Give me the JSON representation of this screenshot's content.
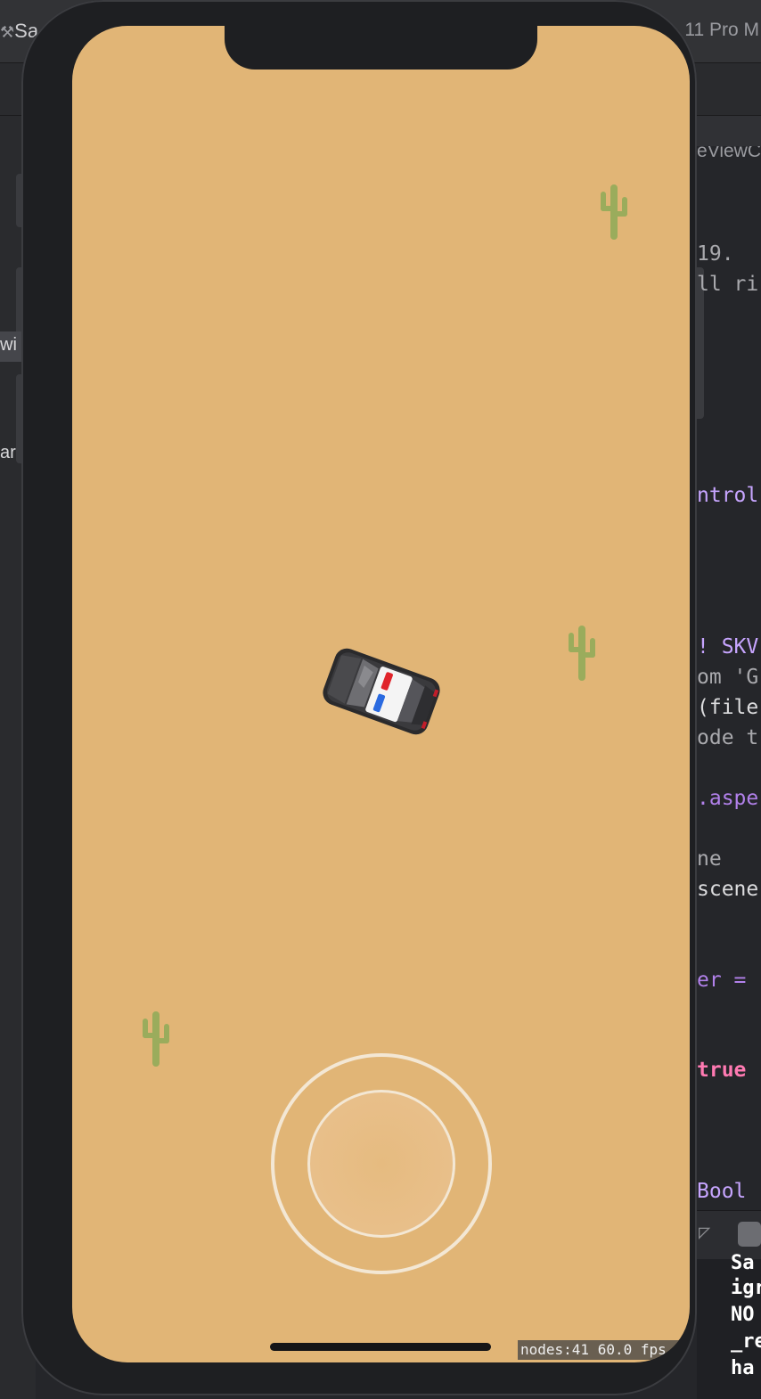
{
  "ide": {
    "scheme_label": "Sa",
    "device_label": "11 Pro M",
    "file_tab_label": "eViewC",
    "left_labels": [
      "wi",
      "ar"
    ],
    "code_lines": [
      {
        "text": "19.",
        "style": "plain"
      },
      {
        "text": "ll ri",
        "style": "plain"
      },
      {
        "text": "ntrol",
        "style": "type"
      },
      {
        "text": "! SKV",
        "style": "type"
      },
      {
        "text": "om 'G",
        "style": "plain"
      },
      {
        "text": "(file",
        "style": "white"
      },
      {
        "text": "ode t",
        "style": "plain"
      },
      {
        "text": ".aspe",
        "style": "prop"
      },
      {
        "text": "ne",
        "style": "plain"
      },
      {
        "text": "scene",
        "style": "white"
      },
      {
        "text": "er =",
        "style": "prop"
      },
      {
        "text": "true",
        "style": "key"
      },
      {
        "text": " Bool",
        "style": "type"
      }
    ],
    "console_lines": [
      "Sa",
      "igr",
      "NO",
      "_re",
      "ha"
    ]
  },
  "game": {
    "background_color": "#e1b576",
    "cacti": [
      "cactus-icon",
      "cactus-icon",
      "cactus-icon"
    ],
    "player": "police-car",
    "joystick": "virtual-joystick",
    "stats_text": "nodes:41  60.0 fps"
  }
}
